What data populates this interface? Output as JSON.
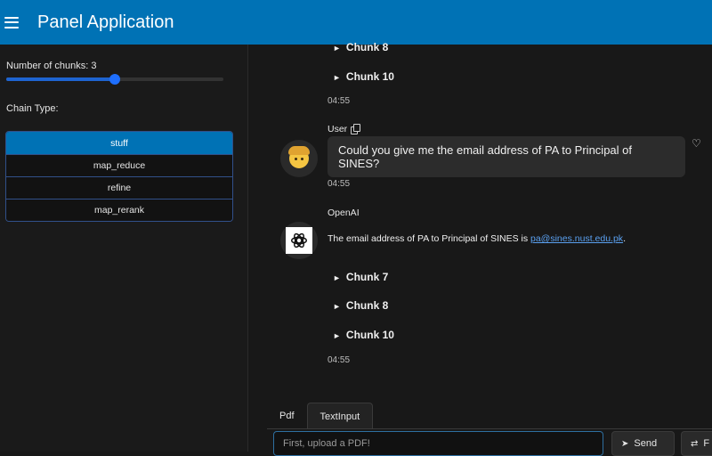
{
  "header": {
    "title": "Panel Application"
  },
  "sidebar": {
    "chunks_label": "Number of chunks: 3",
    "chunks_value": 3,
    "chunks_slider_fraction": 0.5,
    "chain_label": "Chain Type:",
    "chain_options": [
      "stuff",
      "map_reduce",
      "refine",
      "map_rerank"
    ],
    "chain_selected": "stuff"
  },
  "chat": {
    "top_chunks": [
      "Chunk 8",
      "Chunk 10"
    ],
    "top_time": "04:55",
    "user": {
      "name": "User",
      "message": "Could you give me the email address of PA to Principal of SINES?",
      "time": "04:55"
    },
    "assistant": {
      "name": "OpenAI",
      "message_prefix": "The email address of PA to Principal of SINES is ",
      "email": "pa@sines.nust.edu.pk",
      "message_suffix": ".",
      "chunks": [
        "Chunk 7",
        "Chunk 8",
        "Chunk 10"
      ],
      "time": "04:55"
    }
  },
  "input_area": {
    "tabs": [
      "Pdf",
      "TextInput"
    ],
    "active_tab": "TextInput",
    "placeholder": "First, upload a PDF!",
    "send_label": "Send",
    "second_button_label": "F"
  },
  "colors": {
    "header": "#0072b5",
    "accent": "#1e6fff",
    "background": "#181818"
  }
}
